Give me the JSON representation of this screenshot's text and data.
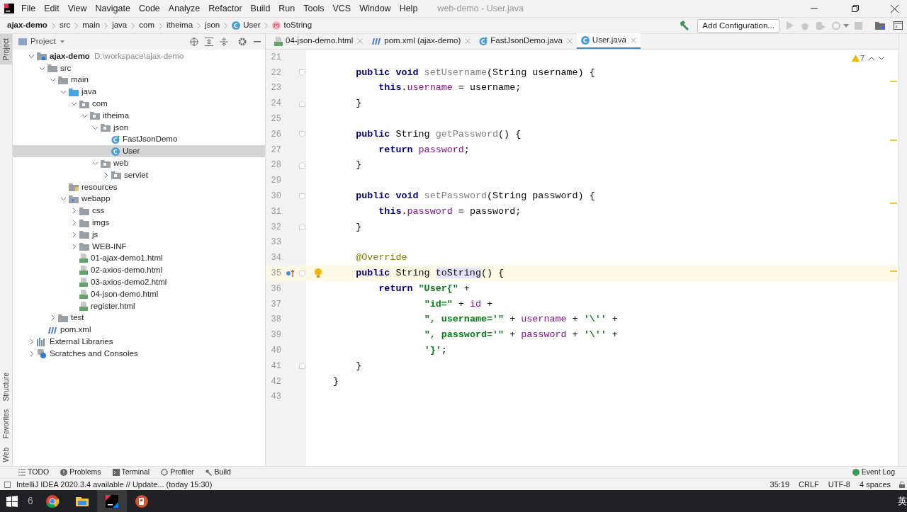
{
  "window": {
    "title": "web-demo - User.java"
  },
  "menu": [
    "File",
    "Edit",
    "View",
    "Navigate",
    "Code",
    "Analyze",
    "Refactor",
    "Build",
    "Run",
    "Tools",
    "VCS",
    "Window",
    "Help"
  ],
  "breadcrumb": [
    {
      "text": "ajax-demo",
      "kind": "project"
    },
    {
      "text": "src",
      "kind": "plain"
    },
    {
      "text": "main",
      "kind": "plain"
    },
    {
      "text": "java",
      "kind": "plain"
    },
    {
      "text": "com",
      "kind": "plain"
    },
    {
      "text": "itheima",
      "kind": "plain"
    },
    {
      "text": "json",
      "kind": "plain"
    },
    {
      "text": "User",
      "kind": "class"
    },
    {
      "text": "toString",
      "kind": "method"
    }
  ],
  "toolbar": {
    "run_config": "Add Configuration..."
  },
  "project_panel": {
    "title": "Project",
    "tree": [
      {
        "label": "ajax-demo",
        "path": "D:\\workspace\\ajax-demo",
        "kind": "module",
        "expanded": true,
        "selected": false,
        "children": [
          {
            "label": "src",
            "kind": "folder",
            "expanded": true,
            "selected": false,
            "children": [
              {
                "label": "main",
                "kind": "folder",
                "expanded": true,
                "selected": false,
                "children": [
                  {
                    "label": "java",
                    "kind": "source",
                    "expanded": true,
                    "selected": false,
                    "children": [
                      {
                        "label": "com",
                        "kind": "package",
                        "expanded": true,
                        "selected": false,
                        "children": [
                          {
                            "label": "itheima",
                            "kind": "package",
                            "expanded": true,
                            "selected": false,
                            "children": [
                              {
                                "label": "json",
                                "kind": "package",
                                "expanded": true,
                                "selected": false,
                                "children": [
                                  {
                                    "label": "FastJsonDemo",
                                    "kind": "runclass",
                                    "selected": false
                                  },
                                  {
                                    "label": "User",
                                    "kind": "class",
                                    "selected": true
                                  }
                                ]
                              },
                              {
                                "label": "web",
                                "kind": "package",
                                "expanded": true,
                                "selected": false,
                                "children": [
                                  {
                                    "label": "servlet",
                                    "kind": "package",
                                    "expanded": false,
                                    "selected": false
                                  }
                                ]
                              }
                            ]
                          }
                        ]
                      }
                    ]
                  },
                  {
                    "label": "resources",
                    "kind": "resources",
                    "selected": false
                  },
                  {
                    "label": "webapp",
                    "kind": "webapp",
                    "expanded": true,
                    "selected": false,
                    "children": [
                      {
                        "label": "css",
                        "kind": "folder",
                        "expanded": false,
                        "selected": false
                      },
                      {
                        "label": "imgs",
                        "kind": "folder",
                        "expanded": false,
                        "selected": false
                      },
                      {
                        "label": "js",
                        "kind": "folder",
                        "expanded": false,
                        "selected": false
                      },
                      {
                        "label": "WEB-INF",
                        "kind": "folder",
                        "expanded": false,
                        "selected": false
                      },
                      {
                        "label": "01-ajax-demo1.html",
                        "kind": "html",
                        "selected": false
                      },
                      {
                        "label": "02-axios-demo.html",
                        "kind": "html",
                        "selected": false
                      },
                      {
                        "label": "03-axios-demo2.html",
                        "kind": "html",
                        "selected": false
                      },
                      {
                        "label": "04-json-demo.html",
                        "kind": "html",
                        "selected": false
                      },
                      {
                        "label": "register.html",
                        "kind": "html",
                        "selected": false
                      }
                    ]
                  }
                ]
              },
              {
                "label": "test",
                "kind": "folder",
                "expanded": false,
                "selected": false
              }
            ]
          },
          {
            "label": "pom.xml",
            "kind": "maven",
            "selected": false
          }
        ]
      },
      {
        "label": "External Libraries",
        "kind": "library",
        "expanded": false,
        "selected": false
      },
      {
        "label": "Scratches and Consoles",
        "kind": "scratches",
        "expanded": false,
        "selected": false
      }
    ]
  },
  "left_strip": [
    {
      "label": "Project",
      "selected": true
    },
    {
      "label": "Structure",
      "selected": false
    },
    {
      "label": "Favorites",
      "selected": false
    },
    {
      "label": "Web",
      "selected": false
    }
  ],
  "editor_tabs": [
    {
      "label": "04-json-demo.html",
      "kind": "html",
      "selected": false
    },
    {
      "label": "pom.xml (ajax-demo)",
      "kind": "maven",
      "selected": false
    },
    {
      "label": "FastJsonDemo.java",
      "kind": "runclass",
      "selected": false
    },
    {
      "label": "User.java",
      "kind": "class",
      "selected": true
    }
  ],
  "editor": {
    "warnings": "7",
    "lines": [
      {
        "number": "21"
      },
      {
        "number": "22",
        "kind": "member",
        "fold_start": true,
        "tokens": [
          {
            "text": "public void ",
            "kind": "kw"
          },
          {
            "text": "setUsername",
            "kind": "unused"
          },
          {
            "text": "(String username) {",
            "kind": "plain"
          }
        ]
      },
      {
        "number": "23",
        "kind": "statement",
        "tokens": [
          {
            "text": "this",
            "kind": "kw"
          },
          {
            "text": ".",
            "kind": "plain"
          },
          {
            "text": "username",
            "kind": "field"
          },
          {
            "text": " = username;",
            "kind": "plain"
          }
        ]
      },
      {
        "number": "24",
        "kind": "member",
        "fold_end": true,
        "tokens": [
          {
            "text": "}",
            "kind": "plain"
          }
        ]
      },
      {
        "number": "25"
      },
      {
        "number": "26",
        "kind": "member",
        "fold_start": true,
        "tokens": [
          {
            "text": "public ",
            "kind": "kw"
          },
          {
            "text": "String ",
            "kind": "plain"
          },
          {
            "text": "getPassword",
            "kind": "unused"
          },
          {
            "text": "() {",
            "kind": "plain"
          }
        ]
      },
      {
        "number": "27",
        "kind": "statement",
        "tokens": [
          {
            "text": "return ",
            "kind": "kw"
          },
          {
            "text": "password",
            "kind": "field"
          },
          {
            "text": ";",
            "kind": "plain"
          }
        ]
      },
      {
        "number": "28",
        "kind": "member",
        "fold_end": true,
        "tokens": [
          {
            "text": "}",
            "kind": "plain"
          }
        ]
      },
      {
        "number": "29"
      },
      {
        "number": "30",
        "kind": "member",
        "fold_start": true,
        "tokens": [
          {
            "text": "public void ",
            "kind": "kw"
          },
          {
            "text": "setPassword",
            "kind": "unused"
          },
          {
            "text": "(String password) {",
            "kind": "plain"
          }
        ]
      },
      {
        "number": "31",
        "kind": "statement",
        "tokens": [
          {
            "text": "this",
            "kind": "kw"
          },
          {
            "text": ".",
            "kind": "plain"
          },
          {
            "text": "password",
            "kind": "field"
          },
          {
            "text": " = password;",
            "kind": "plain"
          }
        ]
      },
      {
        "number": "32",
        "kind": "member",
        "fold_end": true,
        "tokens": [
          {
            "text": "}",
            "kind": "plain"
          }
        ]
      },
      {
        "number": "33"
      },
      {
        "number": "34",
        "kind": "member",
        "tokens": [
          {
            "text": "@Override",
            "kind": "annotation"
          }
        ]
      },
      {
        "number": "35",
        "kind": "member",
        "fold_start": true,
        "current": true,
        "override": true,
        "bulb": true,
        "tokens": [
          {
            "text": "public ",
            "kind": "kw"
          },
          {
            "text": "String ",
            "kind": "plain"
          },
          {
            "text": "toString",
            "kind": "usage"
          },
          {
            "text": "() {",
            "kind": "plain"
          }
        ]
      },
      {
        "number": "36",
        "kind": "statement",
        "tokens": [
          {
            "text": "return ",
            "kind": "kw"
          },
          {
            "text": "\"User{\"",
            "kind": "string"
          },
          {
            "text": " +",
            "kind": "plain"
          }
        ]
      },
      {
        "number": "37",
        "kind": "continuation",
        "tokens": [
          {
            "text": "\"id=\"",
            "kind": "string"
          },
          {
            "text": " + ",
            "kind": "plain"
          },
          {
            "text": "id",
            "kind": "field"
          },
          {
            "text": " +",
            "kind": "plain"
          }
        ]
      },
      {
        "number": "38",
        "kind": "continuation",
        "tokens": [
          {
            "text": "\", username='\"",
            "kind": "string"
          },
          {
            "text": " + ",
            "kind": "plain"
          },
          {
            "text": "username",
            "kind": "field"
          },
          {
            "text": " + ",
            "kind": "plain"
          },
          {
            "text": "'\\''",
            "kind": "string"
          },
          {
            "text": " +",
            "kind": "plain"
          }
        ]
      },
      {
        "number": "39",
        "kind": "continuation",
        "tokens": [
          {
            "text": "\", password='\"",
            "kind": "string"
          },
          {
            "text": " + ",
            "kind": "plain"
          },
          {
            "text": "password",
            "kind": "field"
          },
          {
            "text": " + ",
            "kind": "plain"
          },
          {
            "text": "'\\''",
            "kind": "string"
          },
          {
            "text": " +",
            "kind": "plain"
          }
        ]
      },
      {
        "number": "40",
        "kind": "continuation",
        "tokens": [
          {
            "text": "'}'",
            "kind": "string"
          },
          {
            "text": ";",
            "kind": "plain"
          }
        ]
      },
      {
        "number": "41",
        "kind": "member",
        "fold_end": true,
        "tokens": [
          {
            "text": "}",
            "kind": "plain"
          }
        ]
      },
      {
        "number": "42",
        "kind": "top",
        "tokens": [
          {
            "text": "}",
            "kind": "plain"
          }
        ]
      },
      {
        "number": "43"
      }
    ]
  },
  "bottom_tools": [
    {
      "label": "TODO",
      "kind": "todo"
    },
    {
      "label": "Problems",
      "kind": "problems"
    },
    {
      "label": "Terminal",
      "kind": "terminal"
    },
    {
      "label": "Profiler",
      "kind": "profiler"
    },
    {
      "label": "Build",
      "kind": "build"
    }
  ],
  "event_log": "Event Log",
  "status_bar": {
    "message": "IntelliJ IDEA 2020.3.4 available // Update... (today 15:30)",
    "items": [
      "35:19",
      "CRLF",
      "UTF-8",
      "4 spaces"
    ]
  },
  "taskbar": {
    "search_text": "6",
    "apps": [
      {
        "kind": "chrome",
        "selected": false
      },
      {
        "kind": "explorer",
        "selected": false
      },
      {
        "kind": "idea",
        "selected": true
      },
      {
        "kind": "powerpoint",
        "selected": false
      }
    ],
    "ime": "英"
  }
}
